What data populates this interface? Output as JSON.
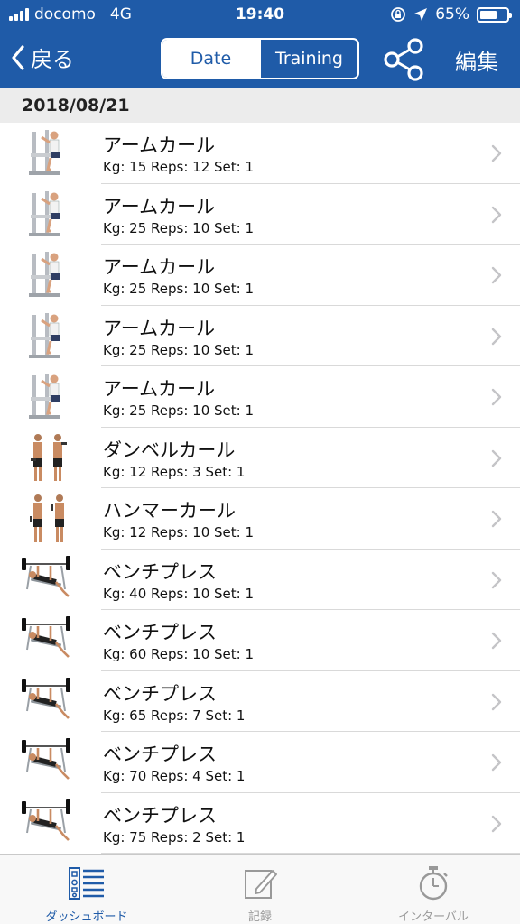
{
  "status_bar": {
    "carrier": "docomo",
    "network": "4G",
    "time": "19:40",
    "battery": "65%",
    "battery_level": 0.65
  },
  "nav": {
    "back_label": "戻る",
    "segments": [
      "Date",
      "Training"
    ],
    "active_segment": "Date",
    "share_icon": "share-icon",
    "edit_label": "編集"
  },
  "section": {
    "date": "2018/08/21"
  },
  "records": [
    {
      "name": "アームカール",
      "detail": "Kg: 15 Reps: 12 Set: 1",
      "icon": "arm-curl-machine"
    },
    {
      "name": "アームカール",
      "detail": "Kg: 25 Reps: 10 Set: 1",
      "icon": "arm-curl-machine"
    },
    {
      "name": "アームカール",
      "detail": "Kg: 25 Reps: 10 Set: 1",
      "icon": "arm-curl-machine"
    },
    {
      "name": "アームカール",
      "detail": "Kg: 25 Reps: 10 Set: 1",
      "icon": "arm-curl-machine"
    },
    {
      "name": "アームカール",
      "detail": "Kg: 25 Reps: 10 Set: 1",
      "icon": "arm-curl-machine"
    },
    {
      "name": "ダンベルカール",
      "detail": "Kg: 12 Reps: 3 Set: 1",
      "icon": "dumbbell-curl"
    },
    {
      "name": "ハンマーカール",
      "detail": "Kg: 12 Reps: 10 Set: 1",
      "icon": "hammer-curl"
    },
    {
      "name": "ベンチプレス",
      "detail": "Kg: 40 Reps: 10 Set: 1",
      "icon": "bench-press"
    },
    {
      "name": "ベンチプレス",
      "detail": "Kg: 60 Reps: 10 Set: 1",
      "icon": "bench-press"
    },
    {
      "name": "ベンチプレス",
      "detail": "Kg: 65 Reps: 7 Set: 1",
      "icon": "bench-press"
    },
    {
      "name": "ベンチプレス",
      "detail": "Kg: 70 Reps: 4 Set: 1",
      "icon": "bench-press"
    },
    {
      "name": "ベンチプレス",
      "detail": "Kg: 75 Reps: 2 Set: 1",
      "icon": "bench-press"
    }
  ],
  "tabs": [
    {
      "label": "ダッシュボード",
      "icon": "dashboard-icon",
      "active": true
    },
    {
      "label": "記録",
      "icon": "record-edit-icon",
      "active": false
    },
    {
      "label": "インターバル",
      "icon": "stopwatch-icon",
      "active": false
    }
  ],
  "colors": {
    "brand": "#1f5ba8",
    "section_bg": "#ececec",
    "inactive_tab": "#999999"
  }
}
